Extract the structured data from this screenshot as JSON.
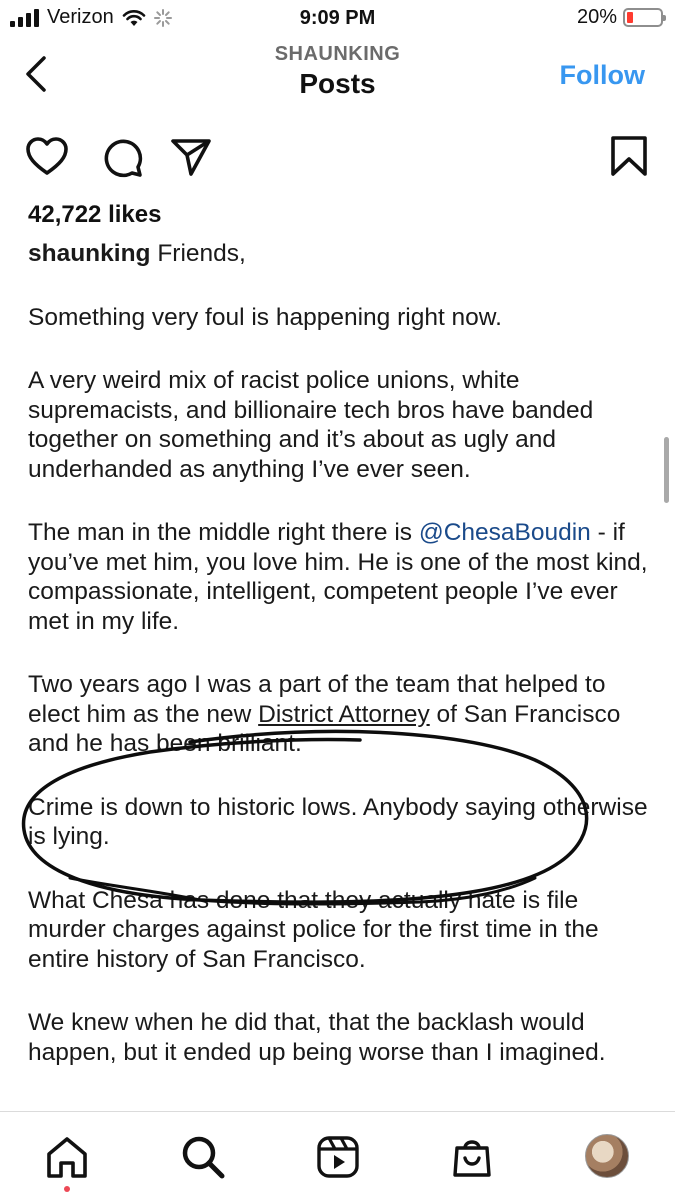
{
  "status_bar": {
    "carrier": "Verizon",
    "time": "9:09 PM",
    "battery": "20%"
  },
  "header": {
    "username": "SHAUNKING",
    "title": "Posts",
    "follow_label": "Follow"
  },
  "post": {
    "likes": "42,722 likes",
    "author": "shaunking",
    "caption": {
      "p1": "Friends,",
      "p2": "Something very foul is happening right now.",
      "p3": "A very weird mix of racist police unions, white supremacists, and billionaire tech bros have banded together on something and it’s about as ugly and underhanded as anything I’ve ever seen.",
      "p4_pre": "The man in the middle right there is ",
      "p4_mention": "@ChesaBoudin",
      "p4_post": " - if you’ve met him, you love him. He is one of the most kind, compassionate, intelligent, competent people I’ve ever met in my life.",
      "p5_pre": "Two years ago I was a part of the team that helped to elect him as the new ",
      "p5_underlined": "District Attorney",
      "p5_post": " of San Francisco and he has been brilliant.",
      "p6": "Crime is down to historic lows. Anybody saying otherwise is lying.",
      "p7": "What Chesa has done that they actually hate is file murder charges against police for the first time in the entire history of San Francisco.",
      "p8": "We knew when he did that, that the backlash would happen, but it ended up being worse than I imagined."
    }
  },
  "icons": {
    "back": "chevron-left-icon",
    "like": "heart-icon",
    "comment": "comment-icon",
    "share": "send-icon",
    "save": "bookmark-icon",
    "nav": [
      "home-icon",
      "search-icon",
      "reels-icon",
      "shop-icon",
      "profile-avatar"
    ]
  },
  "colors": {
    "follow": "#3897f0",
    "mention": "#1a4a8a",
    "battery_low": "#ff3b30",
    "nav_dot": "#ed4956"
  }
}
